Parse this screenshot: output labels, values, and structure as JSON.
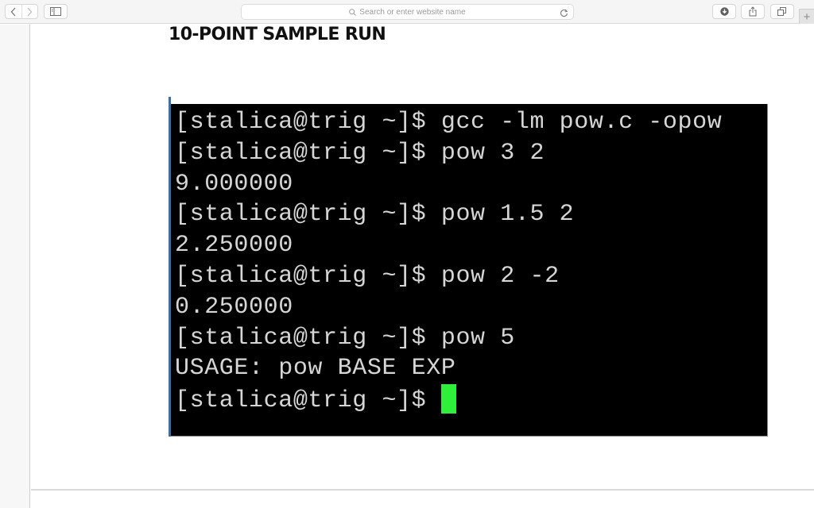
{
  "browser": {
    "address_placeholder": "Search or enter website name",
    "icons": {
      "back": "chevron-left-icon",
      "forward": "chevron-right-icon",
      "sidebar": "sidebar-icon",
      "search": "magnifier-icon",
      "reload": "reload-icon",
      "downloads": "download-icon",
      "share": "share-icon",
      "tabs": "tabs-overview-icon",
      "new_tab": "plus-icon"
    },
    "new_tab_label": "+"
  },
  "slide": {
    "title": "10-POINT SAMPLE RUN"
  },
  "terminal": {
    "prompt": "[stalica@trig ~]$ ",
    "cursor_color": "#2ef03a",
    "lines": [
      {
        "type": "command",
        "text": "[stalica@trig ~]$ gcc -lm pow.c -opow"
      },
      {
        "type": "command",
        "text": "[stalica@trig ~]$ pow 3 2"
      },
      {
        "type": "output",
        "text": "9.000000"
      },
      {
        "type": "command",
        "text": "[stalica@trig ~]$ pow 1.5 2"
      },
      {
        "type": "output",
        "text": "2.250000"
      },
      {
        "type": "command",
        "text": "[stalica@trig ~]$ pow 2 -2"
      },
      {
        "type": "output",
        "text": "0.250000"
      },
      {
        "type": "command",
        "text": "[stalica@trig ~]$ pow 5"
      },
      {
        "type": "output",
        "text": "USAGE: pow BASE EXP"
      },
      {
        "type": "prompt",
        "text": "[stalica@trig ~]$ "
      }
    ]
  }
}
